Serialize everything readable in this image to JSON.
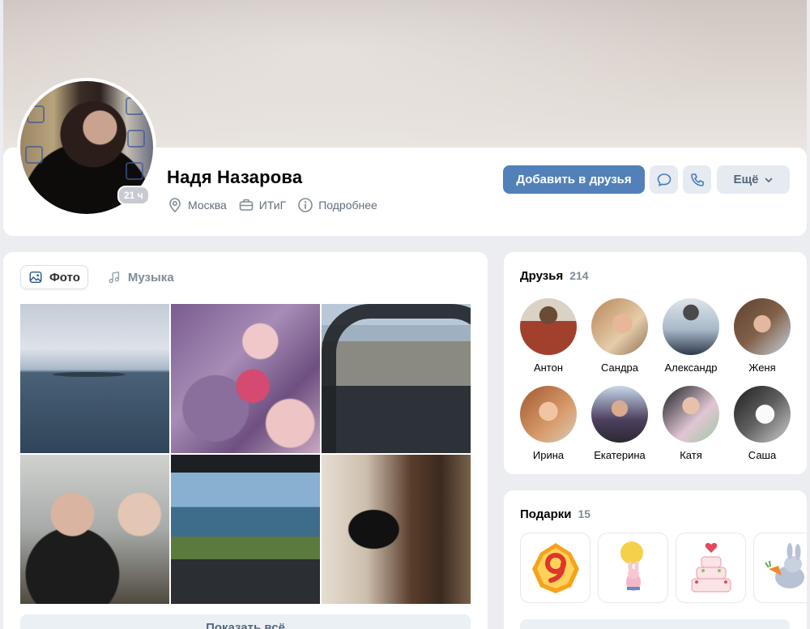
{
  "profile": {
    "name": "Надя Назарова",
    "online": "21 ч",
    "city": "Москва",
    "work": "ИТиГ",
    "details": "Подробнее",
    "add_friend": "Добавить в друзья",
    "more": "Ещё"
  },
  "tabs": [
    {
      "label": "Фото",
      "icon": "image-icon",
      "active": true
    },
    {
      "label": "Музыка",
      "icon": "music-note-icon",
      "active": false
    }
  ],
  "photos": [
    "sea-aerial",
    "flowers",
    "helicopter-cockpit",
    "girls-headsets",
    "helicopter-coast",
    "mirror-selfie"
  ],
  "show_all": "Показать всё",
  "friends": {
    "title": "Друзья",
    "count": "214",
    "items": [
      {
        "name": "Антон"
      },
      {
        "name": "Сандра"
      },
      {
        "name": "Александр"
      },
      {
        "name": "Женя"
      },
      {
        "name": "Ирина"
      },
      {
        "name": "Екатерина"
      },
      {
        "name": "Катя"
      },
      {
        "name": "Саша"
      }
    ]
  },
  "gifts": {
    "title": "Подарки",
    "count": "15",
    "items": [
      "gold-nine-icon",
      "bunny-balloon-icon",
      "wedding-cake-icon",
      "bunny-carrot-icon"
    ]
  },
  "colors": {
    "accent": "#5181b8",
    "secondary_button": "#e5ebf1",
    "page_bg": "#ebedf0"
  }
}
